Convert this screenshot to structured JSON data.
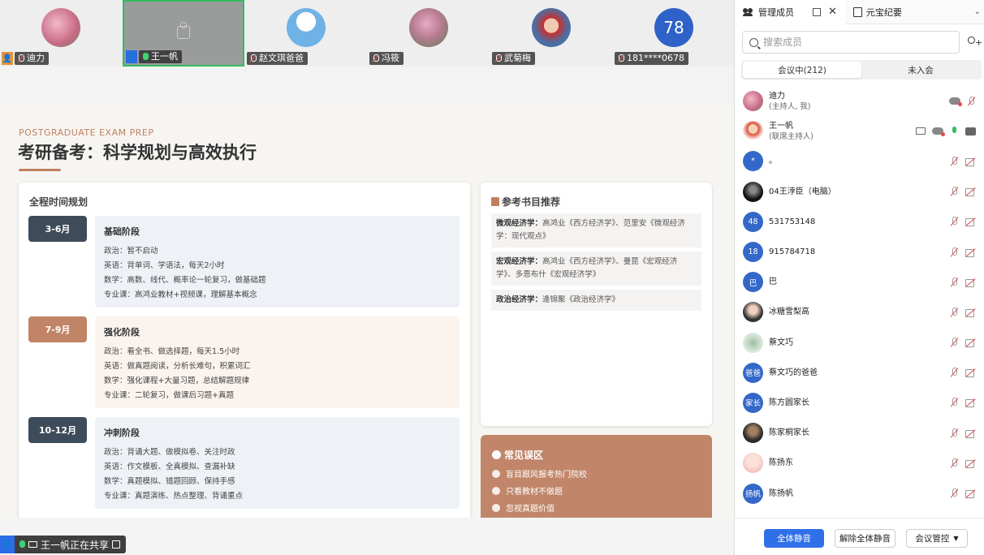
{
  "video_tiles": [
    {
      "name": "迪力",
      "badge": "host",
      "avatar": "photo-pink"
    },
    {
      "name": "王一帆",
      "badge": "cohost",
      "avatar": "camera-off",
      "active": true
    },
    {
      "name": "赵文琪爸爸",
      "avatar": "cartoon-boy"
    },
    {
      "name": "冯筱",
      "avatar": "flowers"
    },
    {
      "name": "武菊梅",
      "avatar": "photo-woman"
    },
    {
      "name": "181****0678",
      "avatar_text": "78"
    }
  ],
  "slide": {
    "kicker": "POSTGRADUATE EXAM PREP",
    "title": "考研备考：科学规划与高效执行",
    "timeline": {
      "heading": "全程时间规划",
      "phases": [
        {
          "period": "3-6月",
          "name": "基础阶段",
          "lines": [
            "政治：暂不启动",
            "英语：背单词、学语法，每天2小时",
            "数学：高数、线代、概率论一轮复习，做基础题",
            "专业课：高鸿业教材+视频课，理解基本概念"
          ]
        },
        {
          "period": "7-9月",
          "name": "强化阶段",
          "lines": [
            "政治：看全书、做选择题，每天1.5小时",
            "英语：做真题阅读，分析长难句，积累词汇",
            "数学：强化课程+大量习题，总结解题规律",
            "专业课：二轮复习，做课后习题+真题"
          ]
        },
        {
          "period": "10-12月",
          "name": "冲刺阶段",
          "lines": [
            "政治：背诵大题、做模拟卷、关注时政",
            "英语：作文模板、全真模拟、查漏补缺",
            "数学：真题模拟、错题回顾、保持手感",
            "专业课：真题演练、热点整理、背诵重点"
          ]
        }
      ]
    },
    "books": {
      "heading": "参考书目推荐",
      "items": [
        {
          "label": "微观经济学：",
          "text": "高鸿业《西方经济学》、范里安《微观经济学：现代观点》"
        },
        {
          "label": "宏观经济学：",
          "text": "高鸿业《西方经济学》、曼昆《宏观经济学》、多恩布什《宏观经济学》"
        },
        {
          "label": "政治经济学：",
          "text": "逄锦聚《政治经济学》"
        }
      ]
    },
    "mistakes": {
      "heading": "常见误区",
      "items": [
        "盲目跟风报考热门院校",
        "只看教材不做题",
        "忽视真题价值"
      ]
    }
  },
  "share_bar": {
    "text": "王一帆正在共享"
  },
  "panel": {
    "tab_members": "管理成员",
    "tab_minutes": "元宝纪要",
    "search_placeholder": "搜索成员",
    "seg_in_meeting": "会议中(212)",
    "seg_not_joined": "未入会",
    "members": [
      {
        "name": "迪力",
        "sub": "(主持人, 我)",
        "avatar": "photo-pink",
        "icons": [
          "cloud",
          "mic-off"
        ]
      },
      {
        "name": "王一帆",
        "sub": "(联席主持人)",
        "avatar": "cartoon-girl",
        "icons": [
          "screen",
          "cloud",
          "mic-on",
          "cam-on"
        ]
      },
      {
        "name": "。",
        "avatar_text": "*",
        "icons": [
          "mic-off",
          "cam-off"
        ]
      },
      {
        "name": "04王浡臣（电脑）",
        "avatar": "photo-dark",
        "icons": [
          "mic-off",
          "cam-off"
        ]
      },
      {
        "name": "531753148",
        "avatar_text": "48",
        "icons": [
          "mic-off",
          "cam-off"
        ]
      },
      {
        "name": "915784718",
        "avatar_text": "18",
        "icons": [
          "mic-off",
          "cam-off"
        ]
      },
      {
        "name": "巴",
        "avatar_text": "巴",
        "icons": [
          "mic-off",
          "cam-off"
        ]
      },
      {
        "name": "冰糖雪梨高",
        "avatar": "photo-person",
        "icons": [
          "mic-off",
          "cam-off"
        ]
      },
      {
        "name": "蔡文巧",
        "avatar": "photo-plant",
        "icons": [
          "mic-off",
          "cam-off"
        ]
      },
      {
        "name": "蔡文巧的爸爸",
        "avatar_text": "爸爸",
        "icons": [
          "mic-off",
          "cam-off"
        ]
      },
      {
        "name": "陈方圆家长",
        "avatar_text": "家长",
        "icons": [
          "mic-off",
          "cam-off"
        ]
      },
      {
        "name": "陈家桐家长",
        "avatar": "photo-dark2",
        "icons": [
          "mic-off",
          "cam-off"
        ]
      },
      {
        "name": "陈扬东",
        "avatar": "photo-girl",
        "icons": [
          "mic-off",
          "cam-off"
        ]
      },
      {
        "name": "陈扬帆",
        "avatar_text": "扬帆",
        "icons": [
          "mic-off",
          "cam-off"
        ]
      }
    ],
    "btn_mute_all": "全体静音",
    "btn_unmute_all": "解除全体静音",
    "btn_controls": "会议管控"
  },
  "colors": {
    "accent_blue": "#2f6fe8",
    "brand_brown": "#c18466",
    "dark_slate": "#3e4b5a"
  }
}
